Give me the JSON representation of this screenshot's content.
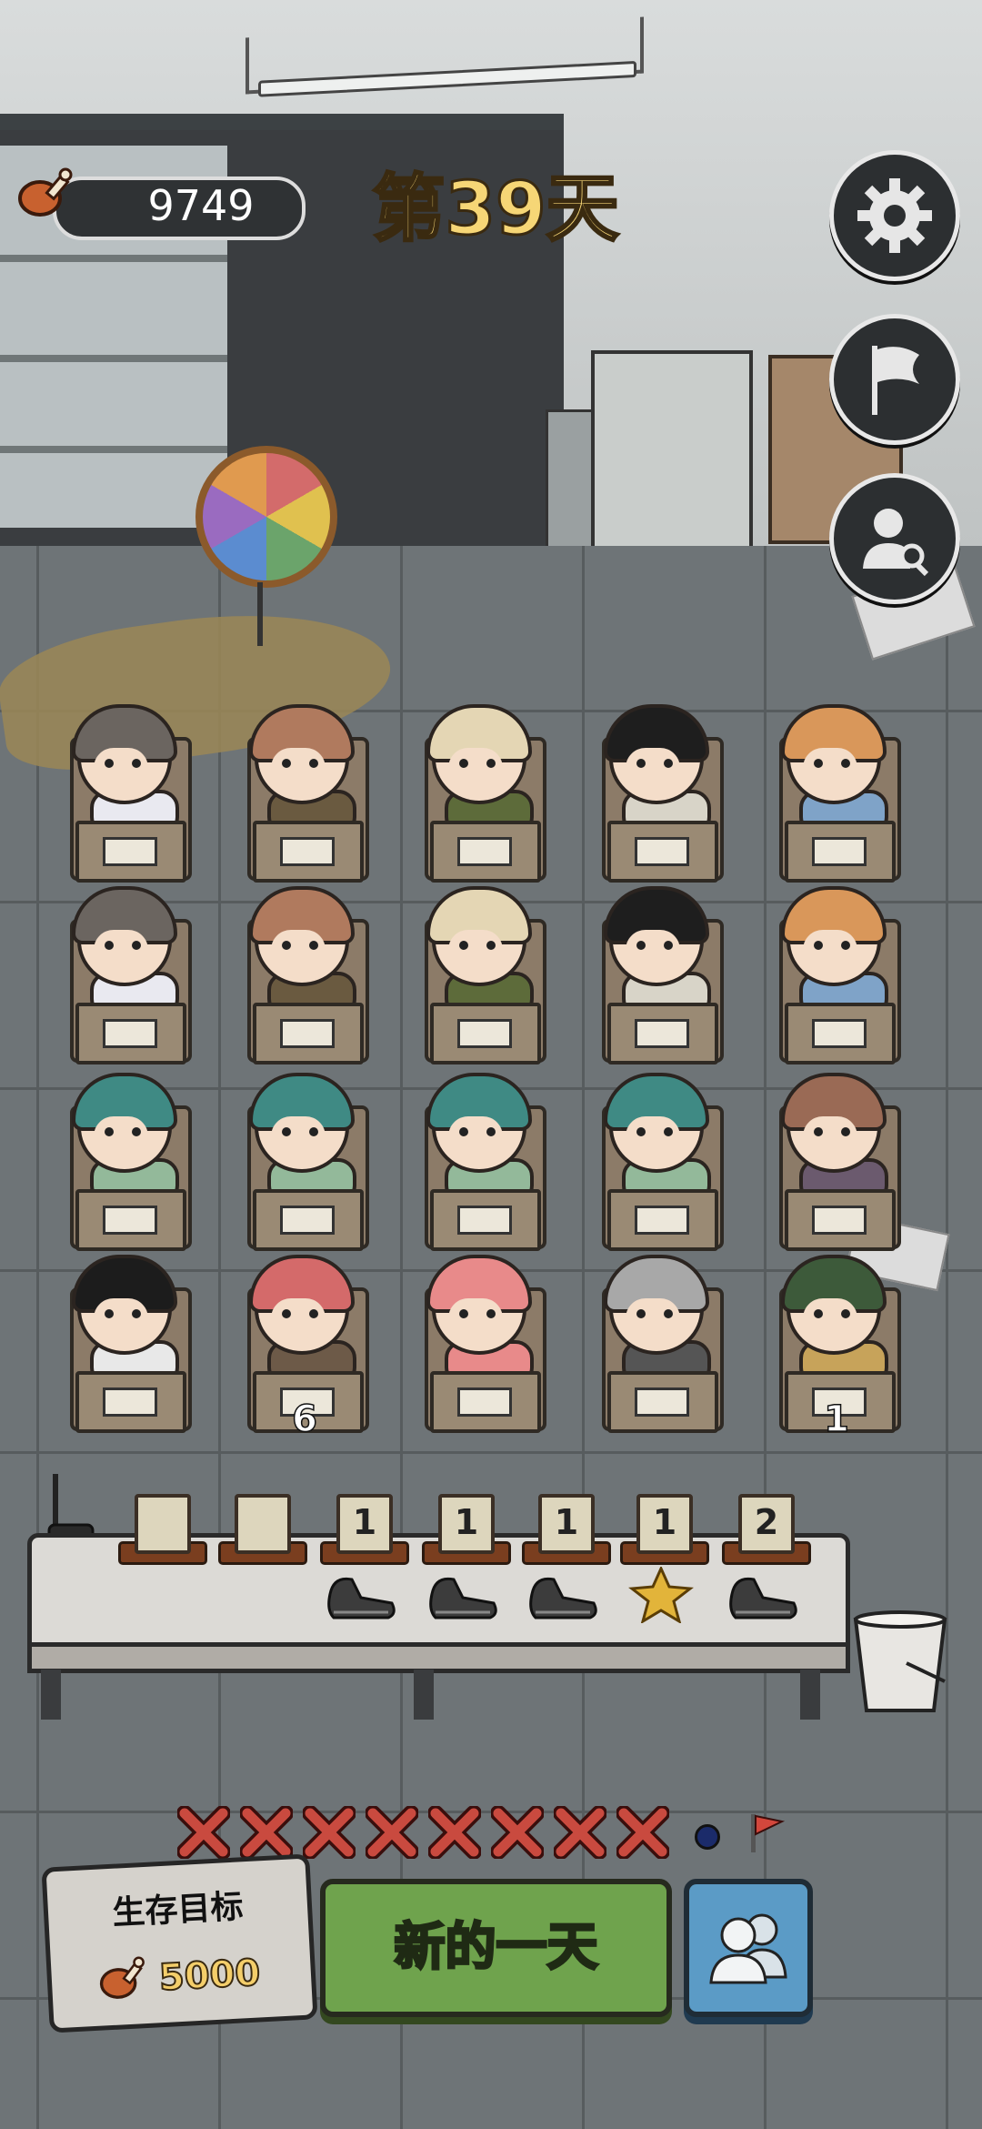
{
  "hud": {
    "food_value": "9749",
    "day_label": "第39天"
  },
  "side_buttons": [
    {
      "name": "settings-button",
      "icon": "gear-icon"
    },
    {
      "name": "surrender-button",
      "icon": "white-flag-icon"
    },
    {
      "name": "inspect-survivor-button",
      "icon": "person-search-icon"
    }
  ],
  "grid": {
    "rows": [
      [
        {
          "id": "r1c1",
          "hair": "#6b6560",
          "body": "#e9e9f0",
          "count": ""
        },
        {
          "id": "r1c2",
          "hair": "#b07a5e",
          "body": "#6a5a40",
          "count": ""
        },
        {
          "id": "r1c3",
          "hair": "#e4d6b4",
          "body": "#5d6b3a",
          "count": ""
        },
        {
          "id": "r1c4",
          "hair": "#1e1e1e",
          "body": "#d8d4c8",
          "count": ""
        },
        {
          "id": "r1c5",
          "hair": "#d9975a",
          "body": "#7fa3c8",
          "count": ""
        }
      ],
      [
        {
          "id": "r2c1",
          "hair": "#6b6560",
          "body": "#e9e9f0",
          "count": ""
        },
        {
          "id": "r2c2",
          "hair": "#b07a5e",
          "body": "#6a5a40",
          "count": ""
        },
        {
          "id": "r2c3",
          "hair": "#e4d6b4",
          "body": "#5d6b3a",
          "count": ""
        },
        {
          "id": "r2c4",
          "hair": "#1e1e1e",
          "body": "#d8d4c8",
          "count": ""
        },
        {
          "id": "r2c5",
          "hair": "#d9975a",
          "body": "#7fa3c8",
          "count": ""
        }
      ],
      [
        {
          "id": "r3c1",
          "hair": "#3f8a84",
          "body": "#93b99a",
          "count": ""
        },
        {
          "id": "r3c2",
          "hair": "#3f8a84",
          "body": "#93b99a",
          "count": ""
        },
        {
          "id": "r3c3",
          "hair": "#3f8a84",
          "body": "#93b99a",
          "count": ""
        },
        {
          "id": "r3c4",
          "hair": "#3f8a84",
          "body": "#93b99a",
          "count": ""
        },
        {
          "id": "r3c5",
          "hair": "#9a6a55",
          "body": "#6b5a6e",
          "count": ""
        }
      ],
      [
        {
          "id": "r4c1",
          "hair": "#1c1c1c",
          "body": "#e8e8e8",
          "count": ""
        },
        {
          "id": "r4c2",
          "hair": "#d46a6a",
          "body": "#6d5a48",
          "count": "6"
        },
        {
          "id": "r4c3",
          "hair": "#e88a8a",
          "body": "#e88a8a",
          "count": ""
        },
        {
          "id": "r4c4",
          "hair": "#a8a8a8",
          "body": "#555555",
          "count": ""
        },
        {
          "id": "r4c5",
          "hair": "#3d5a3a",
          "body": "#c7a35a",
          "count": "1"
        }
      ]
    ]
  },
  "table": {
    "slots": [
      {
        "card": "",
        "item": "none"
      },
      {
        "card": "",
        "item": "none"
      },
      {
        "card": "1",
        "item": "boot-icon"
      },
      {
        "card": "1",
        "item": "boot-icon"
      },
      {
        "card": "1",
        "item": "boot-icon"
      },
      {
        "card": "1",
        "item": "gold-star-icon"
      },
      {
        "card": "2",
        "item": "boot-icon"
      }
    ]
  },
  "progress": {
    "failed_days": 8,
    "marker_icon": "red-flag-icon"
  },
  "goal": {
    "title": "生存目标",
    "target": "5000"
  },
  "actions": {
    "new_day_label": "新的一天",
    "people_icon": "group-icon"
  },
  "colors": {
    "gold_text": "#f6d676",
    "new_day_green": "#6fa34d",
    "people_blue": "#5b9bc6",
    "cross_red": "#c94a3f"
  }
}
